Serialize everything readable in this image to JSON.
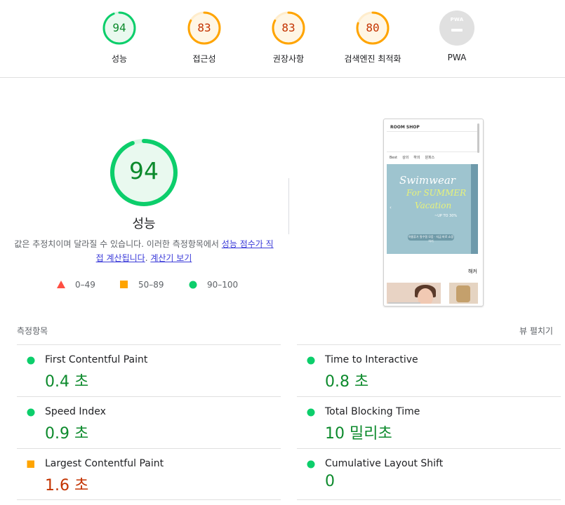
{
  "colors": {
    "pass": "#0cce6b",
    "pass_text": "#0c8a2c",
    "average": "#ffa400",
    "average_text": "#c33300",
    "fail": "#ff4e42",
    "pwa_grey": "#e0e0e0"
  },
  "categories": [
    {
      "score": "94",
      "label": "성능",
      "fraction": 0.94,
      "rating": "pass"
    },
    {
      "score": "83",
      "label": "접근성",
      "fraction": 0.83,
      "rating": "average"
    },
    {
      "score": "83",
      "label": "권장사항",
      "fraction": 0.83,
      "rating": "average"
    },
    {
      "score": "80",
      "label": "검색엔진 최적화",
      "fraction": 0.8,
      "rating": "average"
    },
    {
      "badge": "PWA",
      "label": "PWA"
    }
  ],
  "main_gauge": {
    "score": "94",
    "fraction": 0.94,
    "title": "성능"
  },
  "description": {
    "text1": "값은 추정치이며 달라질 수 있습니다. 이러한 측정항목에서 ",
    "link1": "성능 점수가 직접 계산됩니다",
    "text2": ". ",
    "link2": "계산기 보기"
  },
  "legend": [
    {
      "shape": "triangle",
      "range": "0–49"
    },
    {
      "shape": "square",
      "range": "50–89"
    },
    {
      "shape": "circle",
      "range": "90–100"
    }
  ],
  "screenshot": {
    "logo": "ROOM SHOP",
    "nav": [
      "Best",
      "상의",
      "하의",
      "원피스"
    ],
    "banner_line1": "Swimwear",
    "banner_line2": "For SUMMER",
    "banner_line3": "Vacation",
    "banner_sub": "~UP TO 30%",
    "banner_button": "여름휴가 필수템 모음 · 지금 바로 쇼핑하기",
    "arrow": "‹",
    "section_text": "해커"
  },
  "metrics": {
    "heading": "측정항목",
    "expand_label": "뷰 펼치기",
    "items": [
      {
        "title": "First Contentful Paint",
        "value": "0.4 초",
        "rating": "pass"
      },
      {
        "title": "Time to Interactive",
        "value": "0.8 초",
        "rating": "pass"
      },
      {
        "title": "Speed Index",
        "value": "0.9 초",
        "rating": "pass"
      },
      {
        "title": "Total Blocking Time",
        "value": "10 밀리초",
        "rating": "pass"
      },
      {
        "title": "Largest Contentful Paint",
        "value": "1.6 초",
        "rating": "average"
      },
      {
        "title": "Cumulative Layout Shift",
        "value": "0",
        "rating": "pass"
      }
    ]
  }
}
